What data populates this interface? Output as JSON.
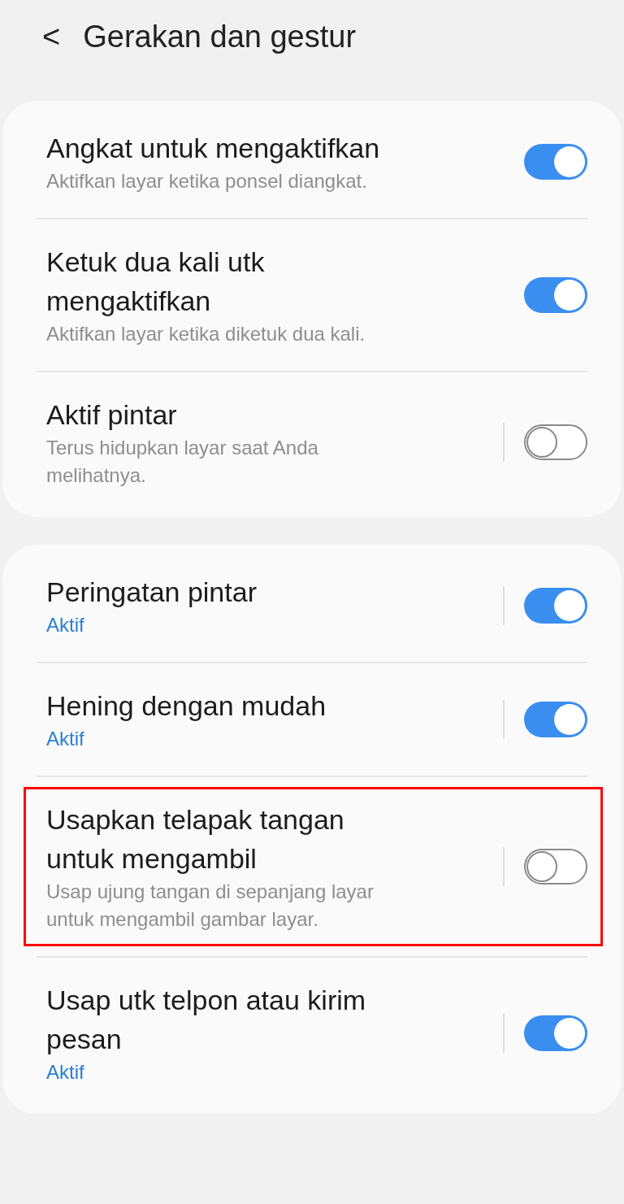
{
  "header": {
    "back_label": "<",
    "title": "Gerakan dan gestur"
  },
  "groups": [
    {
      "items": [
        {
          "title": "Angkat untuk mengaktifkan",
          "summary": "Aktifkan layar ketika ponsel diangkat.",
          "kind": "description",
          "on": true,
          "divider": false,
          "highlighted": false
        },
        {
          "title": "Ketuk dua kali utk mengaktifkan",
          "summary": "Aktifkan layar ketika diketuk dua kali.",
          "kind": "description",
          "on": true,
          "divider": false,
          "highlighted": false
        },
        {
          "title": "Aktif pintar",
          "summary": "Terus hidupkan layar saat Anda melihatnya.",
          "kind": "description",
          "on": false,
          "divider": true,
          "highlighted": false
        }
      ]
    },
    {
      "items": [
        {
          "title": "Peringatan pintar",
          "summary": "Aktif",
          "kind": "status",
          "on": true,
          "divider": true,
          "highlighted": false
        },
        {
          "title": "Hening dengan mudah",
          "summary": "Aktif",
          "kind": "status",
          "on": true,
          "divider": true,
          "highlighted": false
        },
        {
          "title": "Usapkan telapak tangan untuk mengambil",
          "summary": "Usap ujung tangan di sepanjang layar untuk mengambil gambar layar.",
          "kind": "description",
          "on": false,
          "divider": true,
          "highlighted": true
        },
        {
          "title": "Usap utk telpon atau kirim pesan",
          "summary": "Aktif",
          "kind": "status",
          "on": true,
          "divider": true,
          "highlighted": false
        }
      ]
    }
  ]
}
